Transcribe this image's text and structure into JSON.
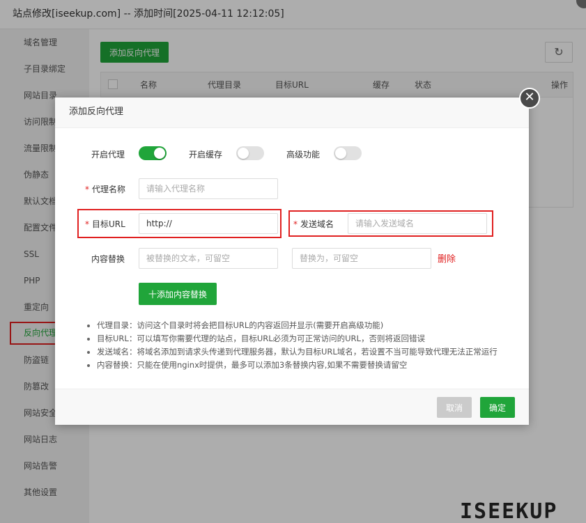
{
  "window": {
    "title": "站点修改[iseekup.com] -- 添加时间[2025-04-11 12:12:05]"
  },
  "sidebar": {
    "items": [
      {
        "label": "域名管理"
      },
      {
        "label": "子目录绑定"
      },
      {
        "label": "网站目录"
      },
      {
        "label": "访问限制"
      },
      {
        "label": "流量限制"
      },
      {
        "label": "伪静态"
      },
      {
        "label": "默认文档"
      },
      {
        "label": "配置文件"
      },
      {
        "label": "SSL"
      },
      {
        "label": "PHP"
      },
      {
        "label": "重定向"
      },
      {
        "label": "反向代理"
      },
      {
        "label": "防盗链"
      },
      {
        "label": "防篡改"
      },
      {
        "label": "网站安全"
      },
      {
        "label": "网站日志"
      },
      {
        "label": "网站告警"
      },
      {
        "label": "其他设置"
      }
    ]
  },
  "main": {
    "add_button": "添加反向代理",
    "refresh_icon": "refresh-icon",
    "table_headers": [
      "名称",
      "代理目录",
      "目标URL",
      "缓存",
      "状态",
      "操作"
    ]
  },
  "dialog": {
    "title": "添加反向代理",
    "close_icon": "close-icon",
    "toggles": {
      "proxy_label": "开启代理",
      "proxy_on": true,
      "cache_label": "开启缓存",
      "cache_on": false,
      "advanced_label": "高级功能",
      "advanced_on": false
    },
    "fields": {
      "name_label": "代理名称",
      "name_placeholder": "请输入代理名称",
      "url_label": "目标URL",
      "url_value": "http://",
      "host_label": "发送域名",
      "host_placeholder": "请输入发送域名",
      "replace_label": "内容替换",
      "replace_from_placeholder": "被替换的文本，可留空",
      "replace_to_placeholder": "替换为，可留空",
      "required_mark": "*"
    },
    "delete_link": "删除",
    "add_replace_button": "添加内容替换",
    "add_replace_plus": "十",
    "tips": [
      "代理目录：访问这个目录时将会把目标URL的内容返回并显示(需要开启高级功能)",
      "目标URL：可以填写你需要代理的站点，目标URL必须为可正常访问的URL，否则将返回错误",
      "发送域名：将域名添加到请求头传递到代理服务器，默认为目标URL域名，若设置不当可能导致代理无法正常运行",
      "内容替换：只能在使用nginx时提供，最多可以添加3条替换内容,如果不需要替换请留空"
    ],
    "cancel_button": "取消",
    "confirm_button": "确定"
  },
  "watermark": "ISEEKUP",
  "colors": {
    "accent": "#20a53a",
    "danger": "#e02020"
  }
}
